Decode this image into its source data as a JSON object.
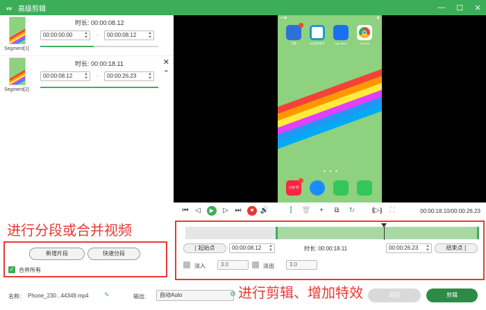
{
  "window": {
    "title": "高级剪辑",
    "brand_color": "#3cae5a",
    "close_glyph": "✕",
    "min_glyph": "—",
    "max_glyph": "☐"
  },
  "segments": [
    {
      "label": "Segment[1]",
      "duration": "时长: 00:00:08.12",
      "start": "00:00:00.00",
      "end": "00:00:08.12",
      "progress": 0.45
    },
    {
      "label": "Segment[2]",
      "duration": "时长: 00:00:18.11",
      "start": "00:00:08.12",
      "end": "00:00:26.23",
      "progress": 1.0
    }
  ],
  "phone": {
    "apps_top": [
      {
        "name": "百度",
        "color": "#2e6fd9",
        "badge": "1"
      },
      {
        "name": "QQ同步助手",
        "color": "#ffffff"
      },
      {
        "name": "App Store",
        "color": "#1b6ff3"
      },
      {
        "name": "Chrome",
        "color": "#ffffff"
      }
    ],
    "apps_dock": [
      {
        "name": "小红书",
        "color": "#ff2442",
        "badge": "1"
      },
      {
        "name": "Safari",
        "color": "#1a8cff"
      },
      {
        "name": "Phone",
        "color": "#34c759"
      },
      {
        "name": "Messages",
        "color": "#34c759"
      }
    ]
  },
  "playback": {
    "timecode": "00:00:18.10/00:00:26.23"
  },
  "annotations": {
    "left": "进行分段或合并视频",
    "right": "进行剪辑、增加特效"
  },
  "segment_actions": {
    "new_segment": "新增片段",
    "quick_split": "快速分段",
    "merge_all": "合并所有"
  },
  "edit": {
    "start_btn": "起始点",
    "start_time": "00:00:08.12",
    "duration": "时长: 00:00:18.11",
    "end_time": "00:00:26.23",
    "end_btn": "结束点",
    "fade_in_label": "淡入",
    "fade_in_value": "3.0",
    "fade_out_label": "淡出",
    "fade_out_value": "3.0"
  },
  "bottom": {
    "name_label": "名称:",
    "name_value": "Phone_230...44349.mp4",
    "output_label": "输出:",
    "output_value": "自动Auto",
    "back_btn": "返回",
    "cut_btn": "剪辑"
  }
}
